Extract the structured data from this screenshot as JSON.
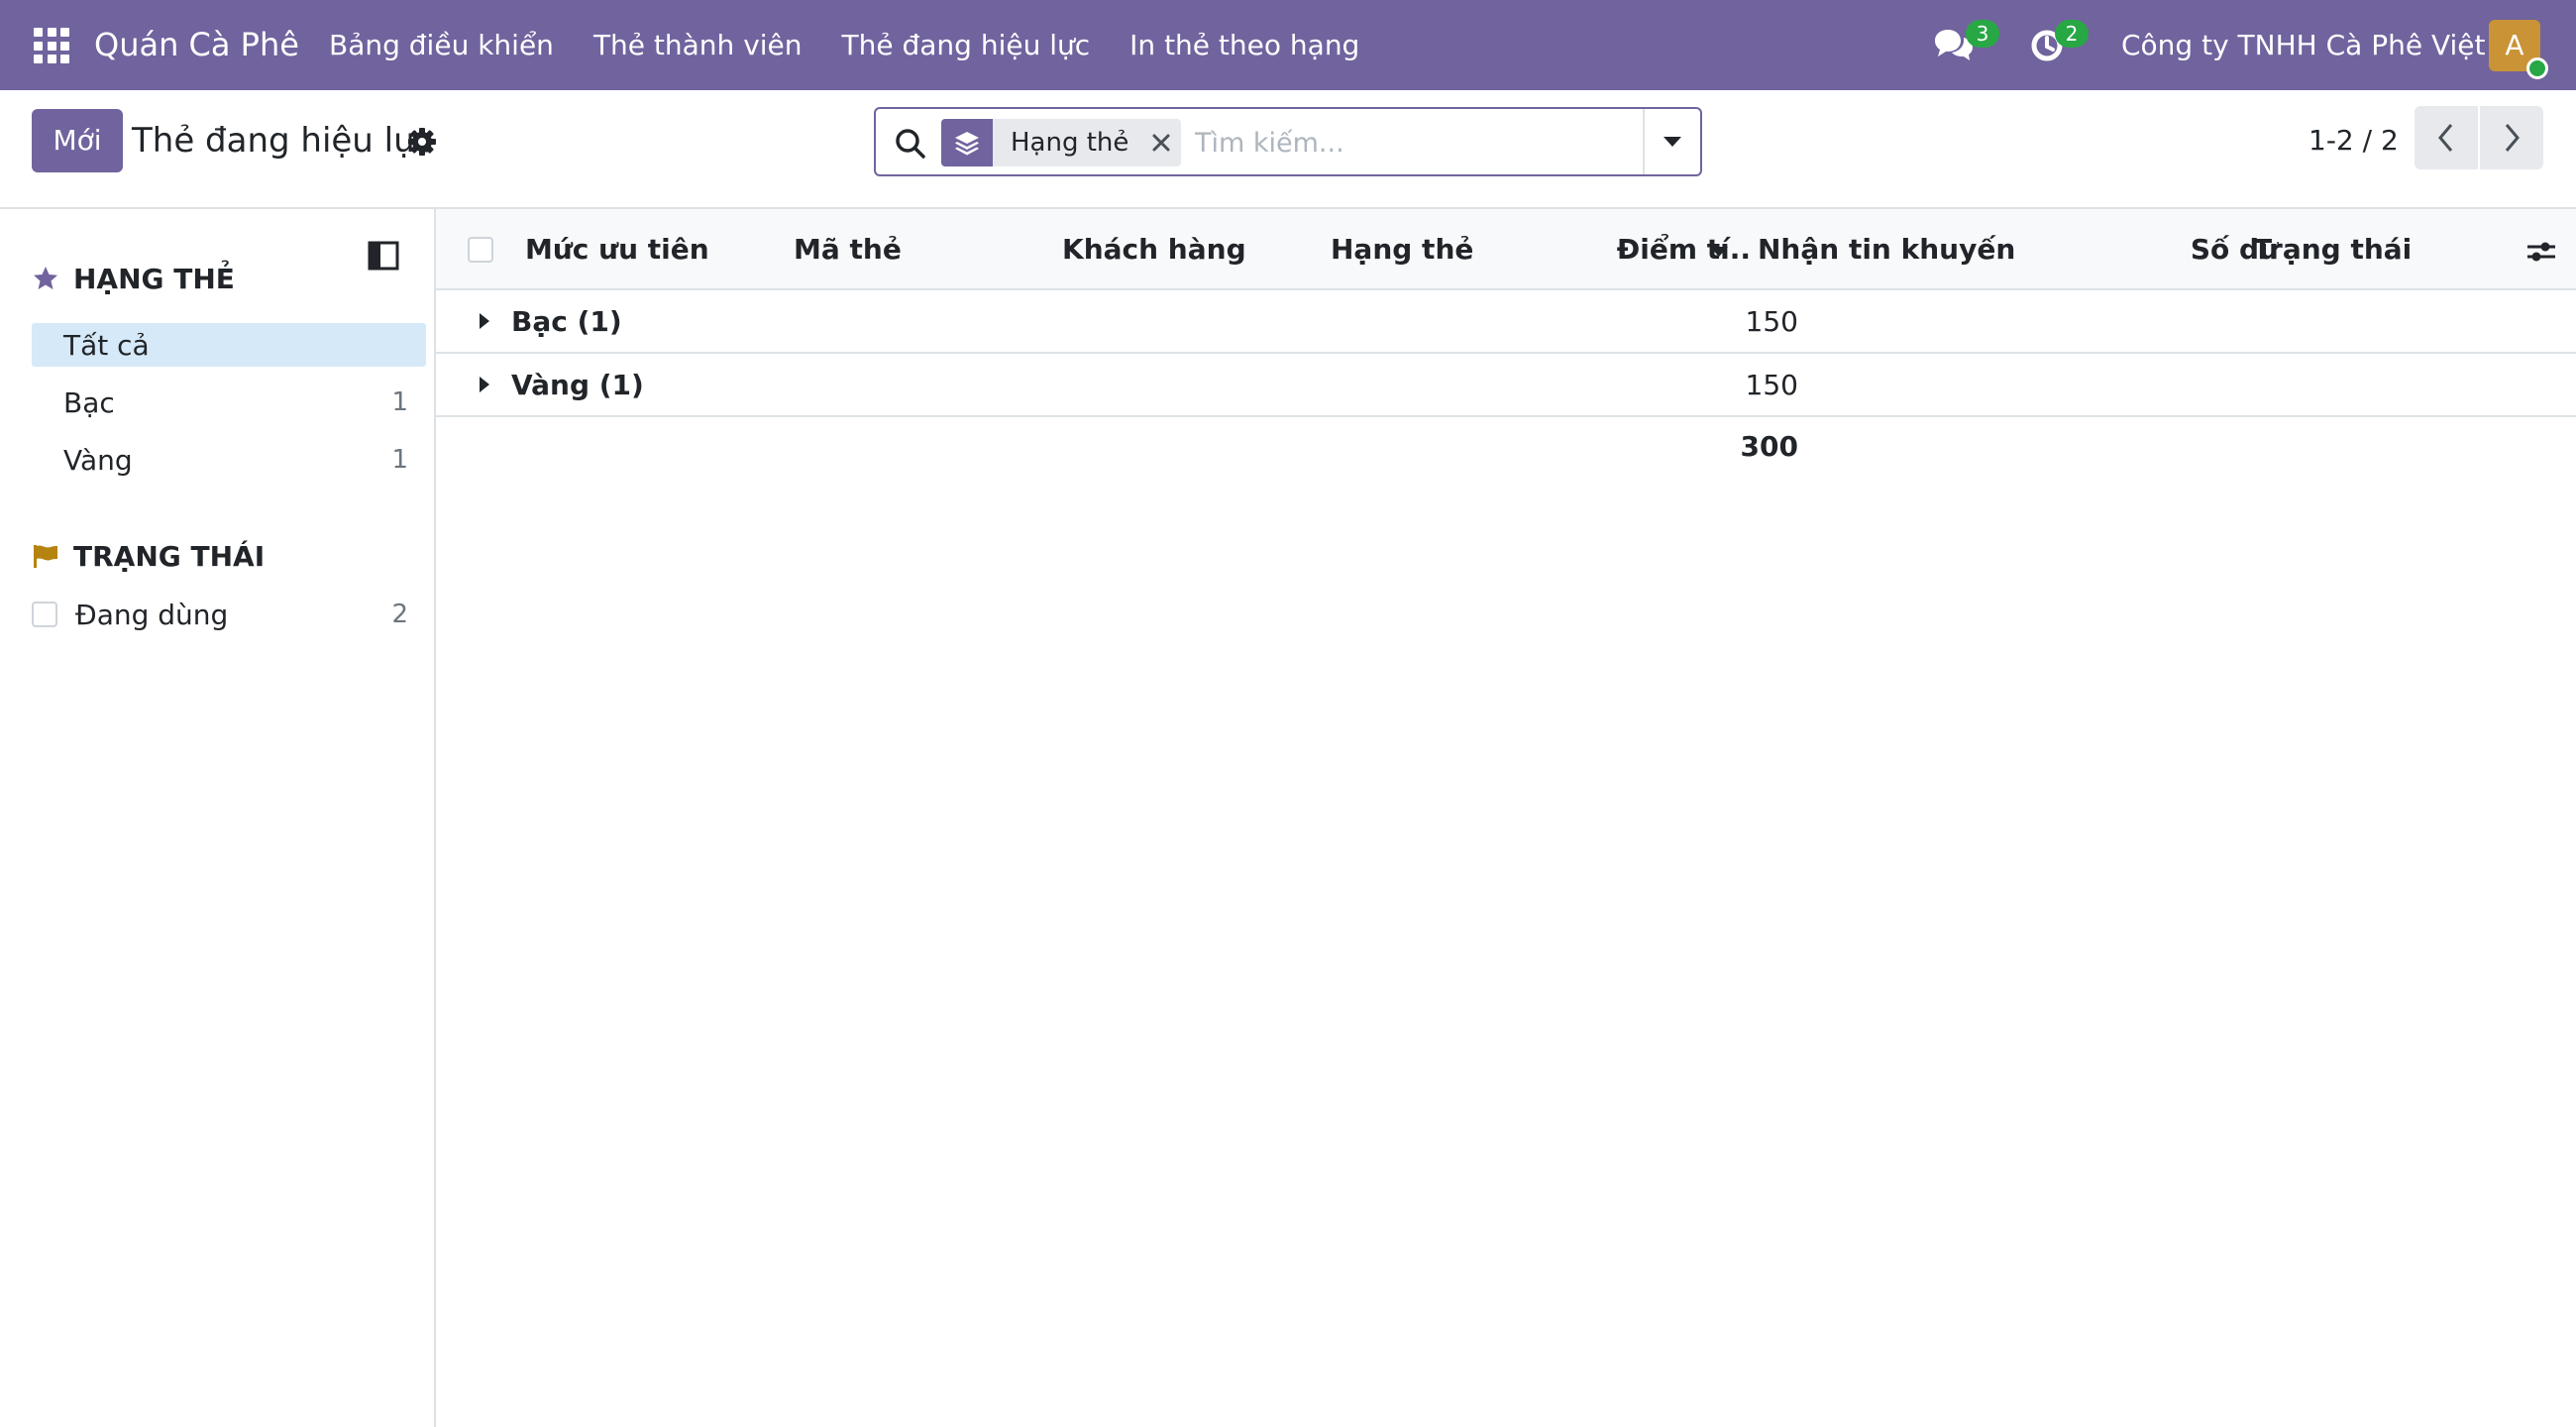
{
  "navbar": {
    "app_name": "Quán Cà Phê",
    "menu": [
      {
        "label": "Bảng điều khiển"
      },
      {
        "label": "Thẻ thành viên"
      },
      {
        "label": "Thẻ đang hiệu lực"
      },
      {
        "label": "In thẻ theo hạng"
      }
    ],
    "messages_count": "3",
    "activities_count": "2",
    "company": "Công ty TNHH Cà Phê Việt",
    "avatar_initial": "A"
  },
  "control": {
    "new_button": "Mới",
    "title": "Thẻ đang hiệu lực",
    "search_facet": "Hạng thẻ",
    "search_placeholder": "Tìm kiếm...",
    "pager": "1-2 / 2"
  },
  "sidebar": {
    "tier_section": {
      "title": "HẠNG THẺ",
      "items": [
        {
          "label": "Tất cả",
          "count": ""
        },
        {
          "label": "Bạc",
          "count": "1"
        },
        {
          "label": "Vàng",
          "count": "1"
        }
      ]
    },
    "status_section": {
      "title": "TRẠNG THÁI",
      "items": [
        {
          "label": "Đang dùng",
          "count": "2"
        }
      ]
    }
  },
  "list": {
    "columns": [
      "Mức ưu tiên",
      "Mã thẻ",
      "Khách hàng",
      "Hạng thẻ",
      "Điểm tí..",
      "Nhận tin khuyến ...",
      "Số dư",
      "Trạng thái"
    ],
    "groups": [
      {
        "label": "Bạc (1)",
        "points": "150"
      },
      {
        "label": "Vàng (1)",
        "points": "150"
      }
    ],
    "total_points": "300"
  },
  "colors": {
    "brand": "#71639e",
    "active_filter": "#d6e9f8",
    "badge": "#28a745",
    "avatar": "#c99336",
    "flag": "#b5830f"
  }
}
